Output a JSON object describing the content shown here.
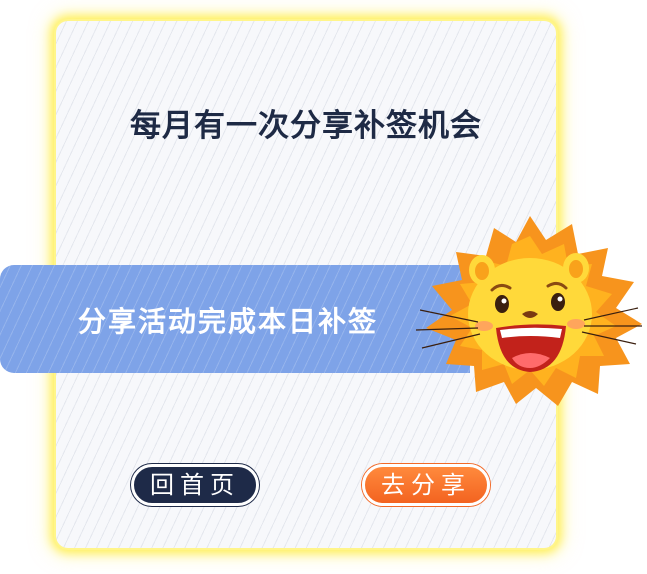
{
  "dialog": {
    "title": "每月有一次分享补签机会",
    "banner_text": "分享活动完成本日补签",
    "home_button_label": "回首页",
    "share_button_label": "去分享"
  },
  "icons": {
    "mascot": "lion-mascot-icon"
  },
  "colors": {
    "card_glow": "#ffec3c",
    "title_text": "#1e2a45",
    "banner": "#7ea3e8",
    "home_button": "#1e2a48",
    "share_button": "#f36320"
  }
}
